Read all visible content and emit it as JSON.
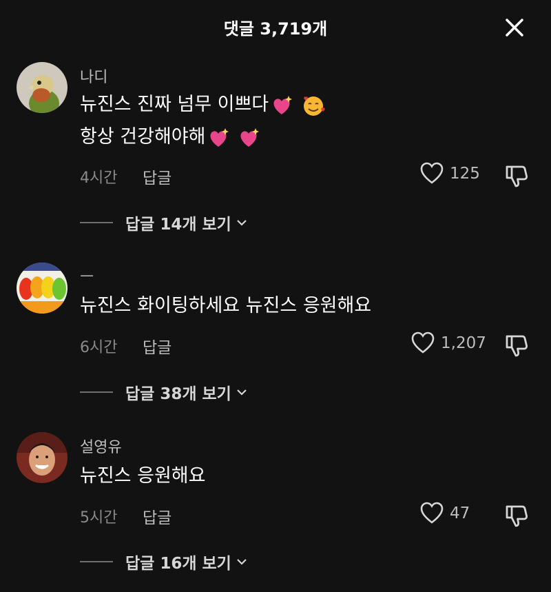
{
  "header": {
    "title": "댓글 3,719개",
    "close_icon": "close-icon"
  },
  "comments": [
    {
      "username": "나디",
      "lines": [
        "뉴진스 진짜 넘무 이쁘다",
        "항상 건강해야해"
      ],
      "time": "4시간",
      "reply_label": "답글",
      "likes": "125",
      "view_replies": "답글 14개 보기"
    },
    {
      "username": "ㅡ",
      "lines": [
        "뉴진스 화이팅하세요 뉴진스 응원해요"
      ],
      "time": "6시간",
      "reply_label": "답글",
      "likes": "1,207",
      "view_replies": "답글 38개 보기"
    },
    {
      "username": "설영유",
      "lines": [
        "뉴진스 응원해요"
      ],
      "time": "5시간",
      "reply_label": "답글",
      "likes": "47",
      "view_replies": "답글 16개 보기"
    }
  ],
  "colors": {
    "background": "#121212",
    "text": "#ffffff",
    "muted": "#8a8a8a",
    "emoji_heart": "#e8458b"
  }
}
